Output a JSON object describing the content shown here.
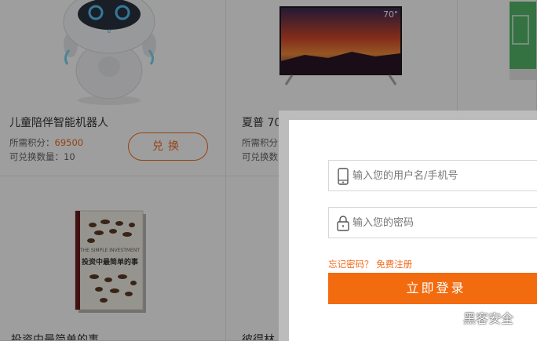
{
  "products": [
    {
      "name": "儿童陪伴智能机器人",
      "points_label": "所需积分：",
      "points_value": "69500",
      "qty_label": "可兑换数量：10",
      "button": "兑换"
    },
    {
      "name": "夏普 70",
      "points_label": "所需积分",
      "qty_label": "可兑换数",
      "tv_size": "70\""
    },
    {
      "name": ""
    },
    {
      "name": "投资中最简单的事",
      "book_title_en": "THE SIMPLE INVESTMENT",
      "book_title_cn": "投资中最简单的事"
    },
    {
      "name": "彼得林"
    }
  ],
  "login": {
    "username_placeholder": "输入您的用户名/手机号",
    "password_placeholder": "输入您的密码",
    "forgot_label": "忘记密码？",
    "register_label": "免费注册",
    "submit_label": "立即登录"
  },
  "watermark": {
    "text": "黑客安全"
  },
  "colors": {
    "accent": "#f26b1d",
    "button": "#f26b0f"
  }
}
